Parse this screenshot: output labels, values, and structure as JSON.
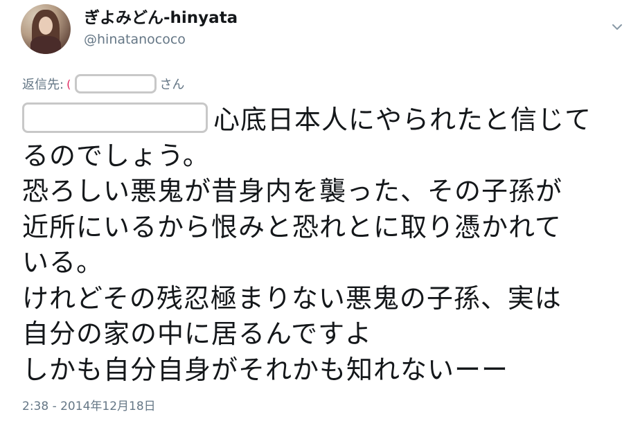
{
  "author": {
    "display_name": "ぎよみどん-hinyata",
    "handle": "@hinatanococo",
    "avatar_icon": "profile-photo"
  },
  "menu_icon": "chevron-down-icon",
  "reply": {
    "prefix": "返信先:",
    "suffix": "さん"
  },
  "tweet": {
    "lines": [
      "心底日本人にやられたと信じて",
      "るのでしょう。",
      "恐ろしい悪鬼が昔身内を襲った、その子孫が",
      "近所にいるから恨みと恐れとに取り憑かれて",
      "いる。",
      "けれどその残忍極まりない悪鬼の子孫、実は",
      "自分の家の中に居るんですよ",
      "しかも自分自身がそれかも知れないーー"
    ]
  },
  "timestamp": "2:38 - 2014年12月18日",
  "colors": {
    "text": "#14171a",
    "secondary": "#657786",
    "redaction_border": "#c8c8c8"
  }
}
